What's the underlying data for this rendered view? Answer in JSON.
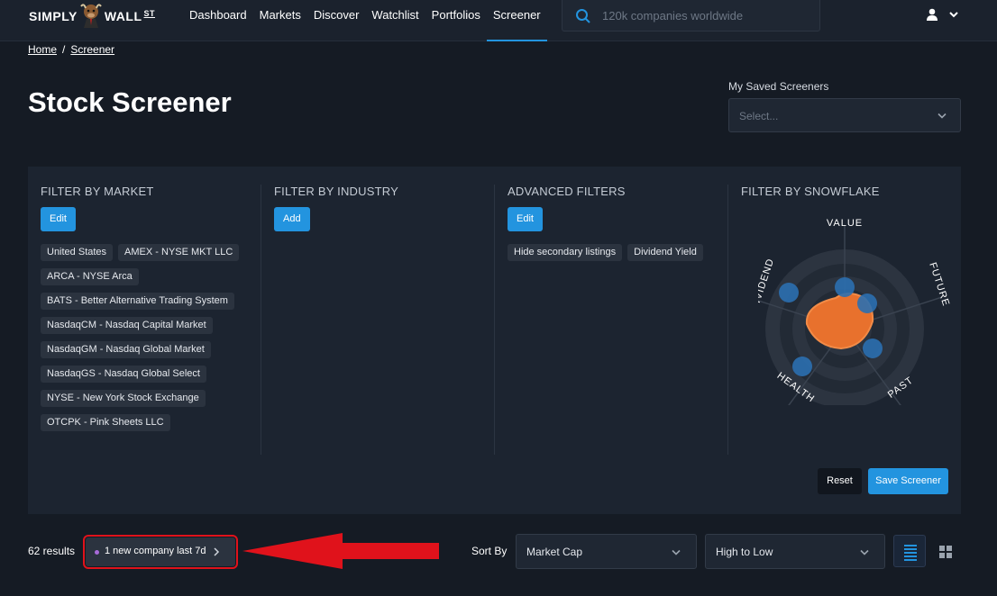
{
  "brand": {
    "name_left": "SIMPLY",
    "name_right": "WALL",
    "name_suffix": "ST"
  },
  "nav": {
    "items": [
      "Dashboard",
      "Markets",
      "Discover",
      "Watchlist",
      "Portfolios",
      "Screener"
    ],
    "active": "Screener"
  },
  "search": {
    "placeholder": "120k companies worldwide"
  },
  "breadcrumb": {
    "home": "Home",
    "separator": "/",
    "current": "Screener"
  },
  "page": {
    "title": "Stock Screener"
  },
  "saved": {
    "label": "My Saved Screeners",
    "placeholder": "Select..."
  },
  "filters": {
    "market": {
      "title": "FILTER BY MARKET",
      "button": "Edit",
      "tags": [
        "United States",
        "AMEX - NYSE MKT LLC",
        "ARCA - NYSE Arca",
        "BATS - Better Alternative Trading System",
        "NasdaqCM - Nasdaq Capital Market",
        "NasdaqGM - Nasdaq Global Market",
        "NasdaqGS - Nasdaq Global Select",
        "NYSE - New York Stock Exchange",
        "OTCPK - Pink Sheets LLC"
      ]
    },
    "industry": {
      "title": "FILTER BY INDUSTRY",
      "button": "Add"
    },
    "advanced": {
      "title": "ADVANCED FILTERS",
      "button": "Edit",
      "tags": [
        "Hide secondary listings",
        "Dividend Yield"
      ]
    },
    "snowflake": {
      "title": "FILTER BY SNOWFLAKE",
      "axes": [
        "VALUE",
        "FUTURE",
        "PAST",
        "HEALTH",
        "DIVIDEND"
      ],
      "min_levels": {
        "VALUE": 2,
        "FUTURE": 2,
        "PAST": 2,
        "HEALTH": 2,
        "DIVIDEND": 2
      },
      "max_levels": 6
    }
  },
  "actions": {
    "reset": "Reset",
    "save": "Save Screener"
  },
  "results": {
    "count_text": "62 results",
    "new_badge": "1 new company last 7d",
    "sort_label": "Sort By",
    "sort_field": "Market Cap",
    "sort_order": "High to Low"
  },
  "colors": {
    "accent": "#2394df",
    "snowflake": "#e8712d",
    "highlight": "#e0121b",
    "new_dot": "#a76ad8"
  }
}
